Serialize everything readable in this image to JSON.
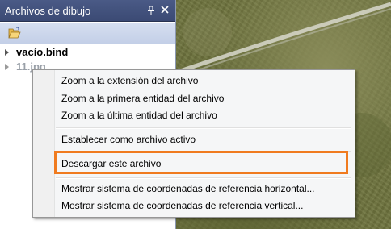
{
  "panel": {
    "title": "Archivos de dibujo",
    "pin_glyph": "⬦",
    "close_glyph": "✕",
    "toolbar": {
      "open_icon": "open-folder-icon"
    },
    "items": [
      {
        "label": "vacío.bind"
      },
      {
        "label": "11.jpg"
      }
    ]
  },
  "context_menu": {
    "items": [
      {
        "label": "Zoom a la extensión del archivo"
      },
      {
        "label": "Zoom a la primera entidad del archivo"
      },
      {
        "label": "Zoom a la última entidad del archivo"
      },
      {
        "label": "Establecer como archivo activo"
      },
      {
        "label": "Descargar este archivo"
      },
      {
        "label": "Mostrar sistema de coordenadas de referencia horizontal..."
      },
      {
        "label": "Mostrar sistema de coordenadas de referencia vertical..."
      }
    ]
  },
  "colors": {
    "title_bar": "#3b4a74",
    "toolbar": "#c3cfe7",
    "highlight": "#f07b1f"
  }
}
